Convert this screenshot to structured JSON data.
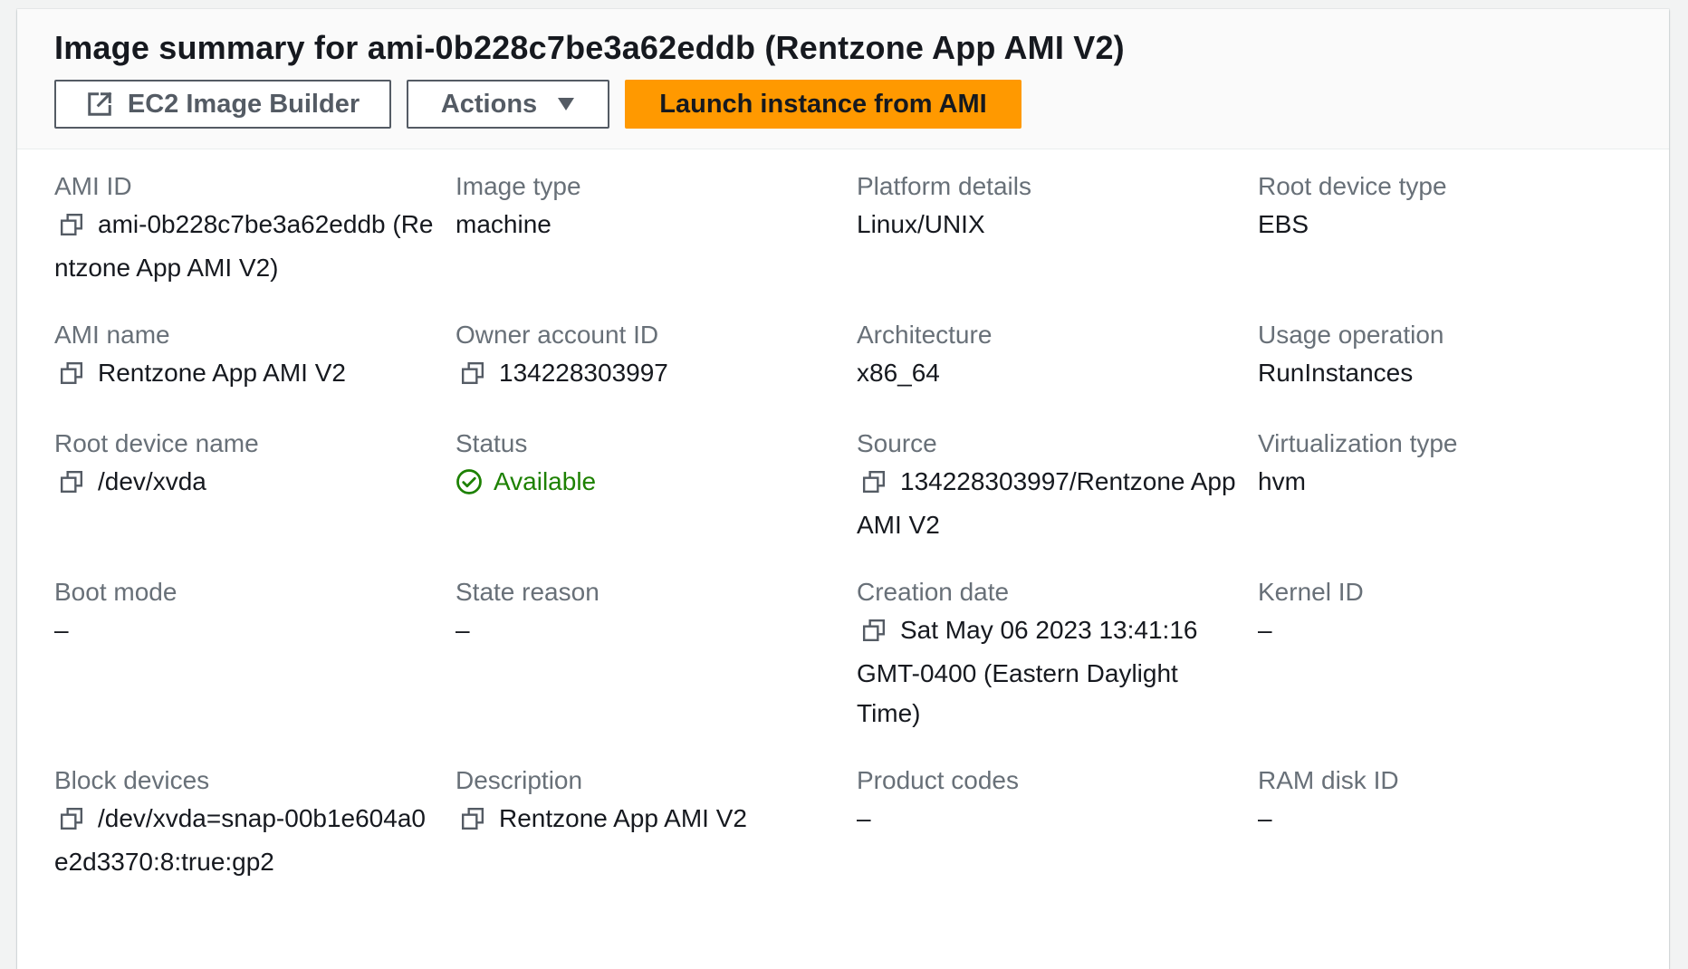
{
  "header": {
    "title": "Image summary for ami-0b228c7be3a62eddb (Rentzone App AMI V2)",
    "buttons": {
      "builder": "EC2 Image Builder",
      "actions": "Actions",
      "launch": "Launch instance from AMI"
    }
  },
  "fields": {
    "ami_id": {
      "label": "AMI ID",
      "value": "ami-0b228c7be3a62eddb (Rentzone App AMI V2)"
    },
    "image_type": {
      "label": "Image type",
      "value": "machine"
    },
    "platform_details": {
      "label": "Platform details",
      "value": "Linux/UNIX"
    },
    "root_device_type": {
      "label": "Root device type",
      "value": "EBS"
    },
    "ami_name": {
      "label": "AMI name",
      "value": "Rentzone App AMI V2"
    },
    "owner_account_id": {
      "label": "Owner account ID",
      "value": "134228303997"
    },
    "architecture": {
      "label": "Architecture",
      "value": "x86_64"
    },
    "usage_operation": {
      "label": "Usage operation",
      "value": "RunInstances"
    },
    "root_device_name": {
      "label": "Root device name",
      "value": "/dev/xvda"
    },
    "status": {
      "label": "Status",
      "value": "Available"
    },
    "source": {
      "label": "Source",
      "value": "134228303997/Rentzone App AMI V2"
    },
    "virtualization_type": {
      "label": "Virtualization type",
      "value": "hvm"
    },
    "boot_mode": {
      "label": "Boot mode",
      "value": "–"
    },
    "state_reason": {
      "label": "State reason",
      "value": "–"
    },
    "creation_date": {
      "label": "Creation date",
      "value": "Sat May 06 2023 13:41:16 GMT-0400 (Eastern Daylight Time)"
    },
    "kernel_id": {
      "label": "Kernel ID",
      "value": "–"
    },
    "block_devices": {
      "label": "Block devices",
      "value": "/dev/xvda=snap-00b1e604a0e2d3370:8:true:gp2"
    },
    "description": {
      "label": "Description",
      "value": "Rentzone App AMI V2"
    },
    "product_codes": {
      "label": "Product codes",
      "value": "–"
    },
    "ram_disk_id": {
      "label": "RAM disk ID",
      "value": "–"
    }
  },
  "colors": {
    "accent": "#ff9900",
    "status_ok": "#1d8102",
    "label": "#687078",
    "text": "#16191f"
  },
  "icons": {
    "external": "external-link-icon",
    "caret": "caret-down-icon",
    "copy": "copy-icon",
    "status": "status-check-icon"
  }
}
